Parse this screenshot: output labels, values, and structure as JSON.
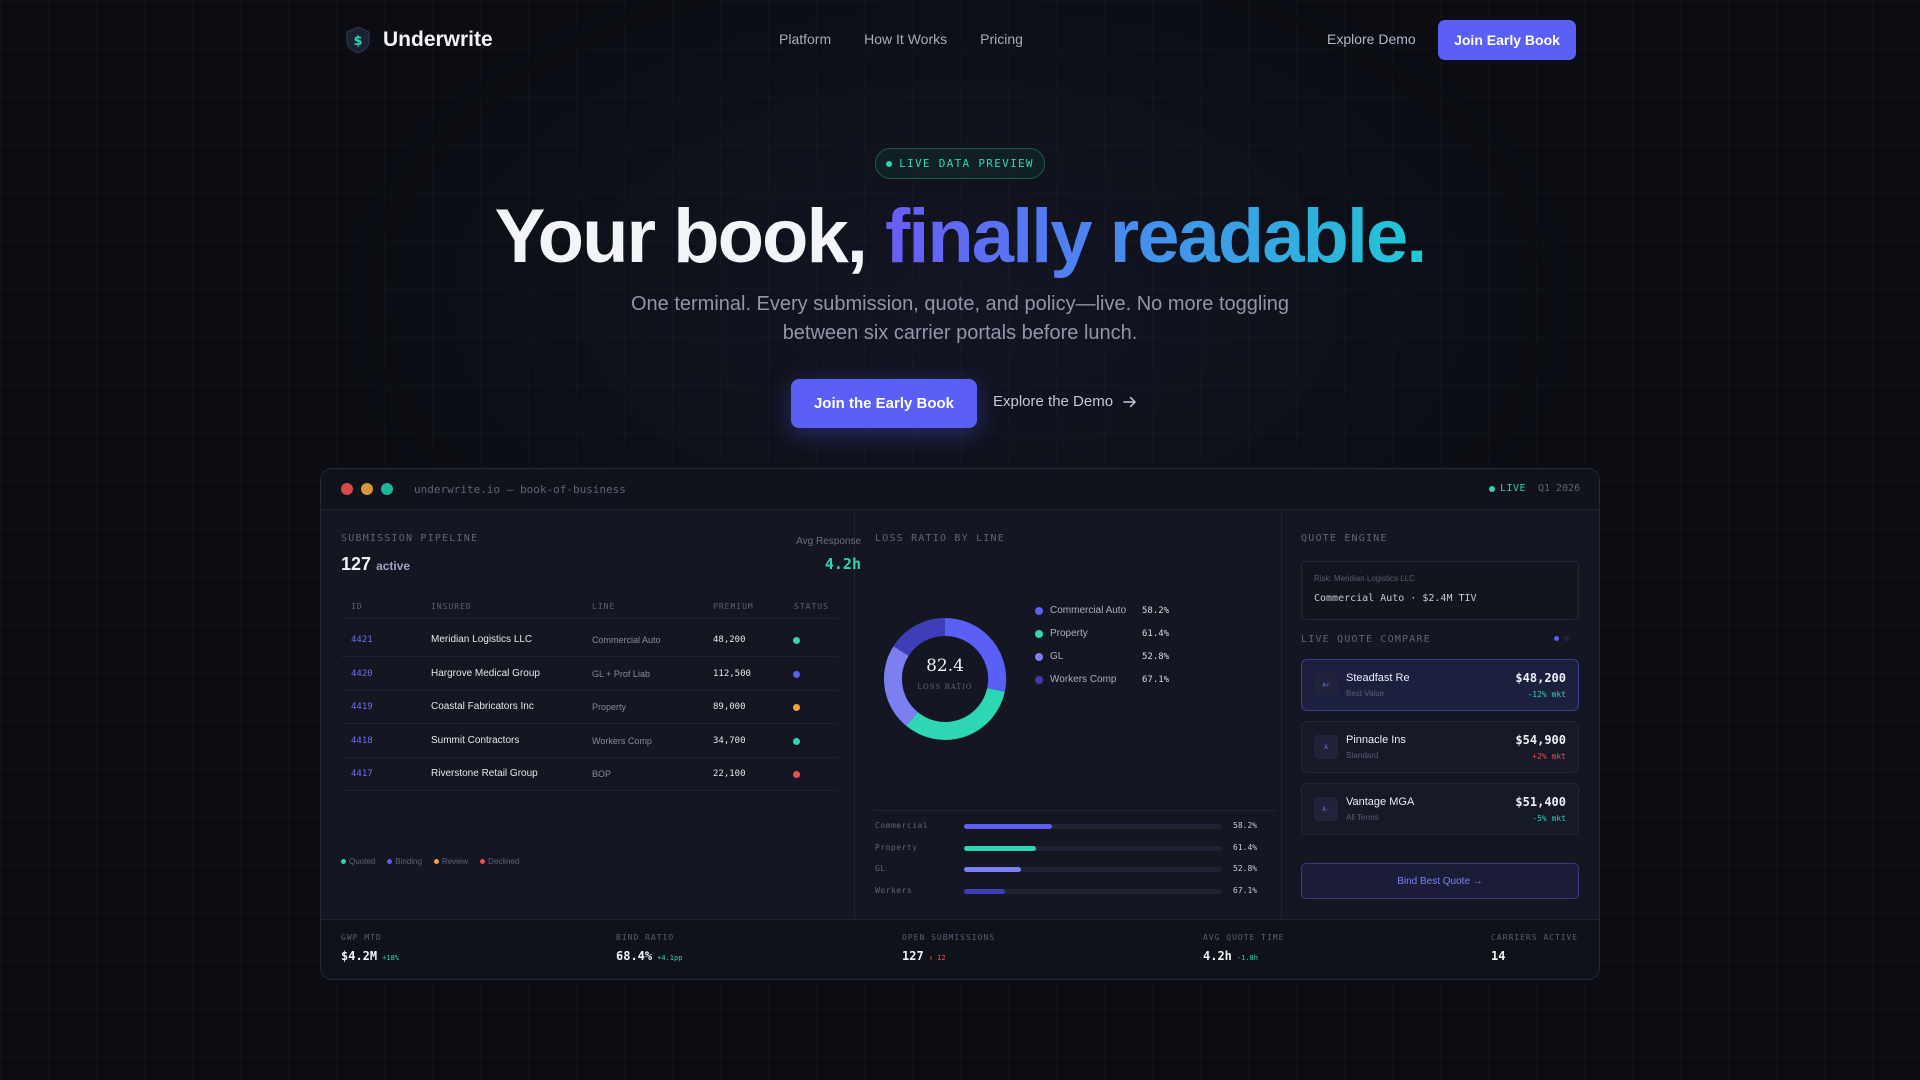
{
  "nav": {
    "brand": "Underwrite",
    "links": [
      "Platform",
      "How It Works",
      "Pricing"
    ],
    "demo": "Explore Demo",
    "cta": "Join Early Book"
  },
  "hero": {
    "badge": "LIVE DATA PREVIEW",
    "title_plain": "Your book, ",
    "title_gradient": "finally readable.",
    "subtitle_line1": "One terminal. Every submission, quote, and policy—live. No more toggling",
    "subtitle_line2": "between six carrier portals before lunch.",
    "cta": "Join the Early Book",
    "demo": "Explore the Demo"
  },
  "terminal": {
    "url": "underwrite.io — book-of-business",
    "live": "LIVE",
    "quarter": "Q1 2026",
    "pipeline": {
      "label": "SUBMISSION PIPELINE",
      "count": "127",
      "count_sub": "active",
      "avg_label": "Avg Response",
      "avg_value": "4.2h",
      "columns": [
        "ID",
        "INSURED",
        "LINE",
        "PREMIUM",
        "STATUS"
      ],
      "rows": [
        {
          "id": "4421",
          "insured": "Meridian Logistics LLC",
          "line": "Commercial Auto",
          "premium": "48,200",
          "status": "Quoted"
        },
        {
          "id": "4420",
          "insured": "Hargrove Medical Group",
          "line": "GL + Prof Liab",
          "premium": "112,500",
          "status": "Binding"
        },
        {
          "id": "4419",
          "insured": "Coastal Fabricators Inc",
          "line": "Property",
          "premium": "89,000",
          "status": "Review"
        },
        {
          "id": "4418",
          "insured": "Summit Contractors",
          "line": "Workers Comp",
          "premium": "34,700",
          "status": "Quoted"
        },
        {
          "id": "4417",
          "insured": "Riverstone Retail Group",
          "line": "BOP",
          "premium": "22,100",
          "status": "Declined"
        }
      ],
      "legend": [
        {
          "label": "Quoted",
          "color": "#2fd6b4"
        },
        {
          "label": "Binding",
          "color": "#5a5ff5"
        },
        {
          "label": "Review",
          "color": "#f2a33a"
        },
        {
          "label": "Declined",
          "color": "#ef4f4f"
        }
      ]
    },
    "loss_ratio": {
      "label": "LOSS RATIO BY LINE",
      "donut_value": "82.4",
      "donut_sub": "LOSS RATIO",
      "lines": [
        {
          "name": "Commercial Auto",
          "value": "58.2%",
          "color": "#5a5ff5"
        },
        {
          "name": "Property",
          "value": "61.4%",
          "color": "#2fd6b4"
        },
        {
          "name": "GL",
          "value": "52.8%",
          "color": "#7b7ff0"
        },
        {
          "name": "Workers Comp",
          "value": "67.1%",
          "color": "#3e3fb8"
        }
      ],
      "bars": [
        {
          "label": "Commercial",
          "value": "58.2%",
          "fill": 0.34,
          "color": "#5a5ff5"
        },
        {
          "label": "Property",
          "value": "61.4%",
          "fill": 0.28,
          "color": "#2fd6b4"
        },
        {
          "label": "GL",
          "value": "52.8%",
          "fill": 0.22,
          "color": "#7b7ff0"
        },
        {
          "label": "Workers",
          "value": "67.1%",
          "fill": 0.16,
          "color": "#3e3fb8"
        }
      ]
    },
    "quote": {
      "label": "QUOTE ENGINE",
      "risk_label": "Risk: Meridian Logistics LLC",
      "risk_value": "Commercial Auto · $2.4M TIV",
      "compare_label": "LIVE QUOTE COMPARE",
      "quotes": [
        {
          "icon": "A+",
          "name": "Steadfast Re",
          "sub": "Best Value",
          "price": "$48,200",
          "delta": "-12% mkt",
          "delta_color": "#2fd6b4"
        },
        {
          "icon": "A",
          "name": "Pinnacle Ins",
          "sub": "Standard",
          "price": "$54,900",
          "delta": "+2% mkt",
          "delta_color": "#ef4f4f"
        },
        {
          "icon": "A-",
          "name": "Vantage MGA",
          "sub": "All Terms",
          "price": "$51,400",
          "delta": "-5% mkt",
          "delta_color": "#2fd6b4"
        }
      ],
      "bind": "Bind Best Quote →"
    },
    "stats": [
      {
        "label": "GWP MTD",
        "value": "$4.2M",
        "delta": "+18%",
        "delta_color": "#2fd6b4"
      },
      {
        "label": "BIND RATIO",
        "value": "68.4%",
        "delta": "+4.1pp",
        "delta_color": "#2fd6b4"
      },
      {
        "label": "OPEN SUBMISSIONS",
        "value": "127",
        "delta": "↑ 12",
        "delta_color": "#ef4f4f"
      },
      {
        "label": "AVG QUOTE TIME",
        "value": "4.2h",
        "delta": "-1.8h",
        "delta_color": "#2fd6b4"
      },
      {
        "label": "CARRIERS ACTIVE",
        "value": "14",
        "delta": "",
        "delta_color": "#2fd6b4"
      }
    ]
  }
}
